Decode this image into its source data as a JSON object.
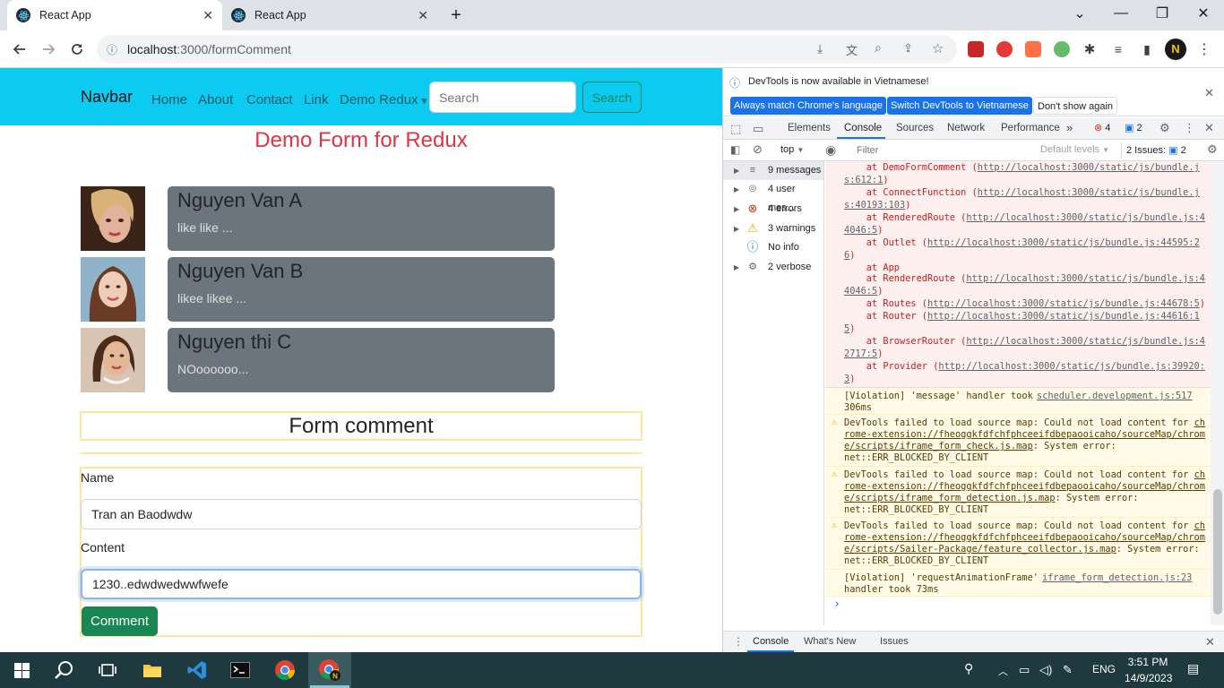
{
  "browser": {
    "tabs": [
      {
        "title": "React App",
        "active": true
      },
      {
        "title": "React App",
        "active": false
      }
    ],
    "new_tab_glyph": "+",
    "url_host": "localhost",
    "url_path": ":3000/formComment",
    "window_controls": {
      "minimize": "—",
      "maximize": "❐",
      "close": "✕",
      "tablist": "⌄"
    }
  },
  "navbar": {
    "brand": "Navbar",
    "links": [
      "Home",
      "About",
      "Contact",
      "Link",
      "Demo Redux"
    ],
    "search_placeholder": "Search",
    "search_button": "Search"
  },
  "page": {
    "title": "Demo Form for Redux",
    "comments": [
      {
        "name": "Nguyen Van A",
        "text": "like like ..."
      },
      {
        "name": "Nguyen Van B",
        "text": "likee likee ..."
      },
      {
        "name": "Nguyen thi C",
        "text": "NOoooooo..."
      }
    ],
    "form": {
      "header": "Form comment",
      "name_label": "Name",
      "name_value": "Tran an Baodwdw",
      "content_label": "Content",
      "content_value": "1230..edwdwedwwfwefe",
      "submit_label": "Comment"
    }
  },
  "devtools": {
    "notice": "DevTools is now available in Vietnamese!",
    "notice_buttons": [
      "Always match Chrome's language",
      "Switch DevTools to Vietnamese",
      "Don't show again"
    ],
    "tabs": [
      "Elements",
      "Console",
      "Sources",
      "Network",
      "Performance"
    ],
    "more_tabs": "»",
    "error_count": "4",
    "message_count": "2",
    "context": "top",
    "filter_placeholder": "Filter",
    "levels": "Default levels",
    "issues": "2 Issues:",
    "issues_count": "2",
    "sidebar": [
      {
        "label": "9 messages",
        "icon": "≡"
      },
      {
        "label": "4 user mes...",
        "icon": "👤"
      },
      {
        "label": "4 errors",
        "icon": "⊗"
      },
      {
        "label": "3 warnings",
        "icon": "⚠"
      },
      {
        "label": "No info",
        "icon": "ⓘ"
      },
      {
        "label": "2 verbose",
        "icon": "⚙"
      }
    ],
    "stack": [
      {
        "pre": "    at DemoFormComment (",
        "link": "http://localhost:3000/static/js/bundle.j",
        "post": ""
      },
      {
        "pre": "",
        "link": "s:612:1",
        "post": ")"
      },
      {
        "pre": "    at ConnectFunction (",
        "link": "http://localhost:3000/static/js/bundle.j",
        "post": ""
      },
      {
        "pre": "",
        "link": "s:40193:103",
        "post": ")"
      },
      {
        "pre": "    at RenderedRoute (",
        "link": "http://localhost:3000/static/js/bundle.js:4",
        "post": ""
      },
      {
        "pre": "",
        "link": "4046:5",
        "post": ")"
      },
      {
        "pre": "    at Outlet (",
        "link": "http://localhost:3000/static/js/bundle.js:44595:2",
        "post": ""
      },
      {
        "pre": "",
        "link": "6",
        "post": ")"
      },
      {
        "pre": "    at App",
        "link": "",
        "post": ""
      },
      {
        "pre": "    at RenderedRoute (",
        "link": "http://localhost:3000/static/js/bundle.js:4",
        "post": ""
      },
      {
        "pre": "",
        "link": "4046:5",
        "post": ")"
      },
      {
        "pre": "    at Routes (",
        "link": "http://localhost:3000/static/js/bundle.js:44678:5",
        "post": ")"
      },
      {
        "pre": "    at Router (",
        "link": "http://localhost:3000/static/js/bundle.js:44616:1",
        "post": ""
      },
      {
        "pre": "",
        "link": "5",
        "post": ")"
      },
      {
        "pre": "    at BrowserRouter (",
        "link": "http://localhost:3000/static/js/bundle.js:4",
        "post": ""
      },
      {
        "pre": "",
        "link": "2717:5",
        "post": ")"
      },
      {
        "pre": "    at Provider (",
        "link": "http://localhost:3000/static/js/bundle.js:39920:",
        "post": ""
      },
      {
        "pre": "",
        "link": "3",
        "post": ")"
      }
    ],
    "violation1": {
      "text": "[Violation] 'message' handler took",
      "source": "scheduler.development.js:517",
      "line2": "306ms"
    },
    "warnings": [
      {
        "l1a": "DevTools failed to load source map: Could not load content for ",
        "l1b": "ch",
        "l2": "rome-extension://fheoggkfdfchfphceeifdbepaooicaho/sourceMap/chrom",
        "l3a": "e/scripts/iframe_form_check.js.map",
        "l3b": ": System error:",
        "l4": "net::ERR_BLOCKED_BY_CLIENT"
      },
      {
        "l1a": "DevTools failed to load source map: Could not load content for ",
        "l1b": "ch",
        "l2": "rome-extension://fheoggkfdfchfphceeifdbepaooicaho/sourceMap/chrom",
        "l3a": "e/scripts/iframe_form_detection.js.map",
        "l3b": ": System error:",
        "l4": "net::ERR_BLOCKED_BY_CLIENT"
      },
      {
        "l1a": "DevTools failed to load source map: Could not load content for ",
        "l1b": "ch",
        "l2": "rome-extension://fheoggkfdfchfphceeifdbepaooicaho/sourceMap/chrom",
        "l3a": "e/scripts/Sailer-Package/feature_collector.js.map",
        "l3b": ": System error:",
        "l4": "net::ERR_BLOCKED_BY_CLIENT"
      }
    ],
    "violation2": {
      "text": "[Violation] 'requestAnimationFrame'",
      "source": "iframe_form_detection.js:23",
      "line2": "handler took 73ms"
    },
    "prompt": "›",
    "drawer_tabs": [
      "Console",
      "What's New",
      "Issues"
    ]
  },
  "taskbar": {
    "time": "3:51 PM",
    "date": "14/9/2023",
    "lang": "ENG"
  },
  "colors": {
    "navbar": "#0dcaf0",
    "title": "#dc3545",
    "card": "#6c757d",
    "success": "#198754",
    "form_border": "#ffe69c",
    "taskbar": "#1f3a3f"
  }
}
